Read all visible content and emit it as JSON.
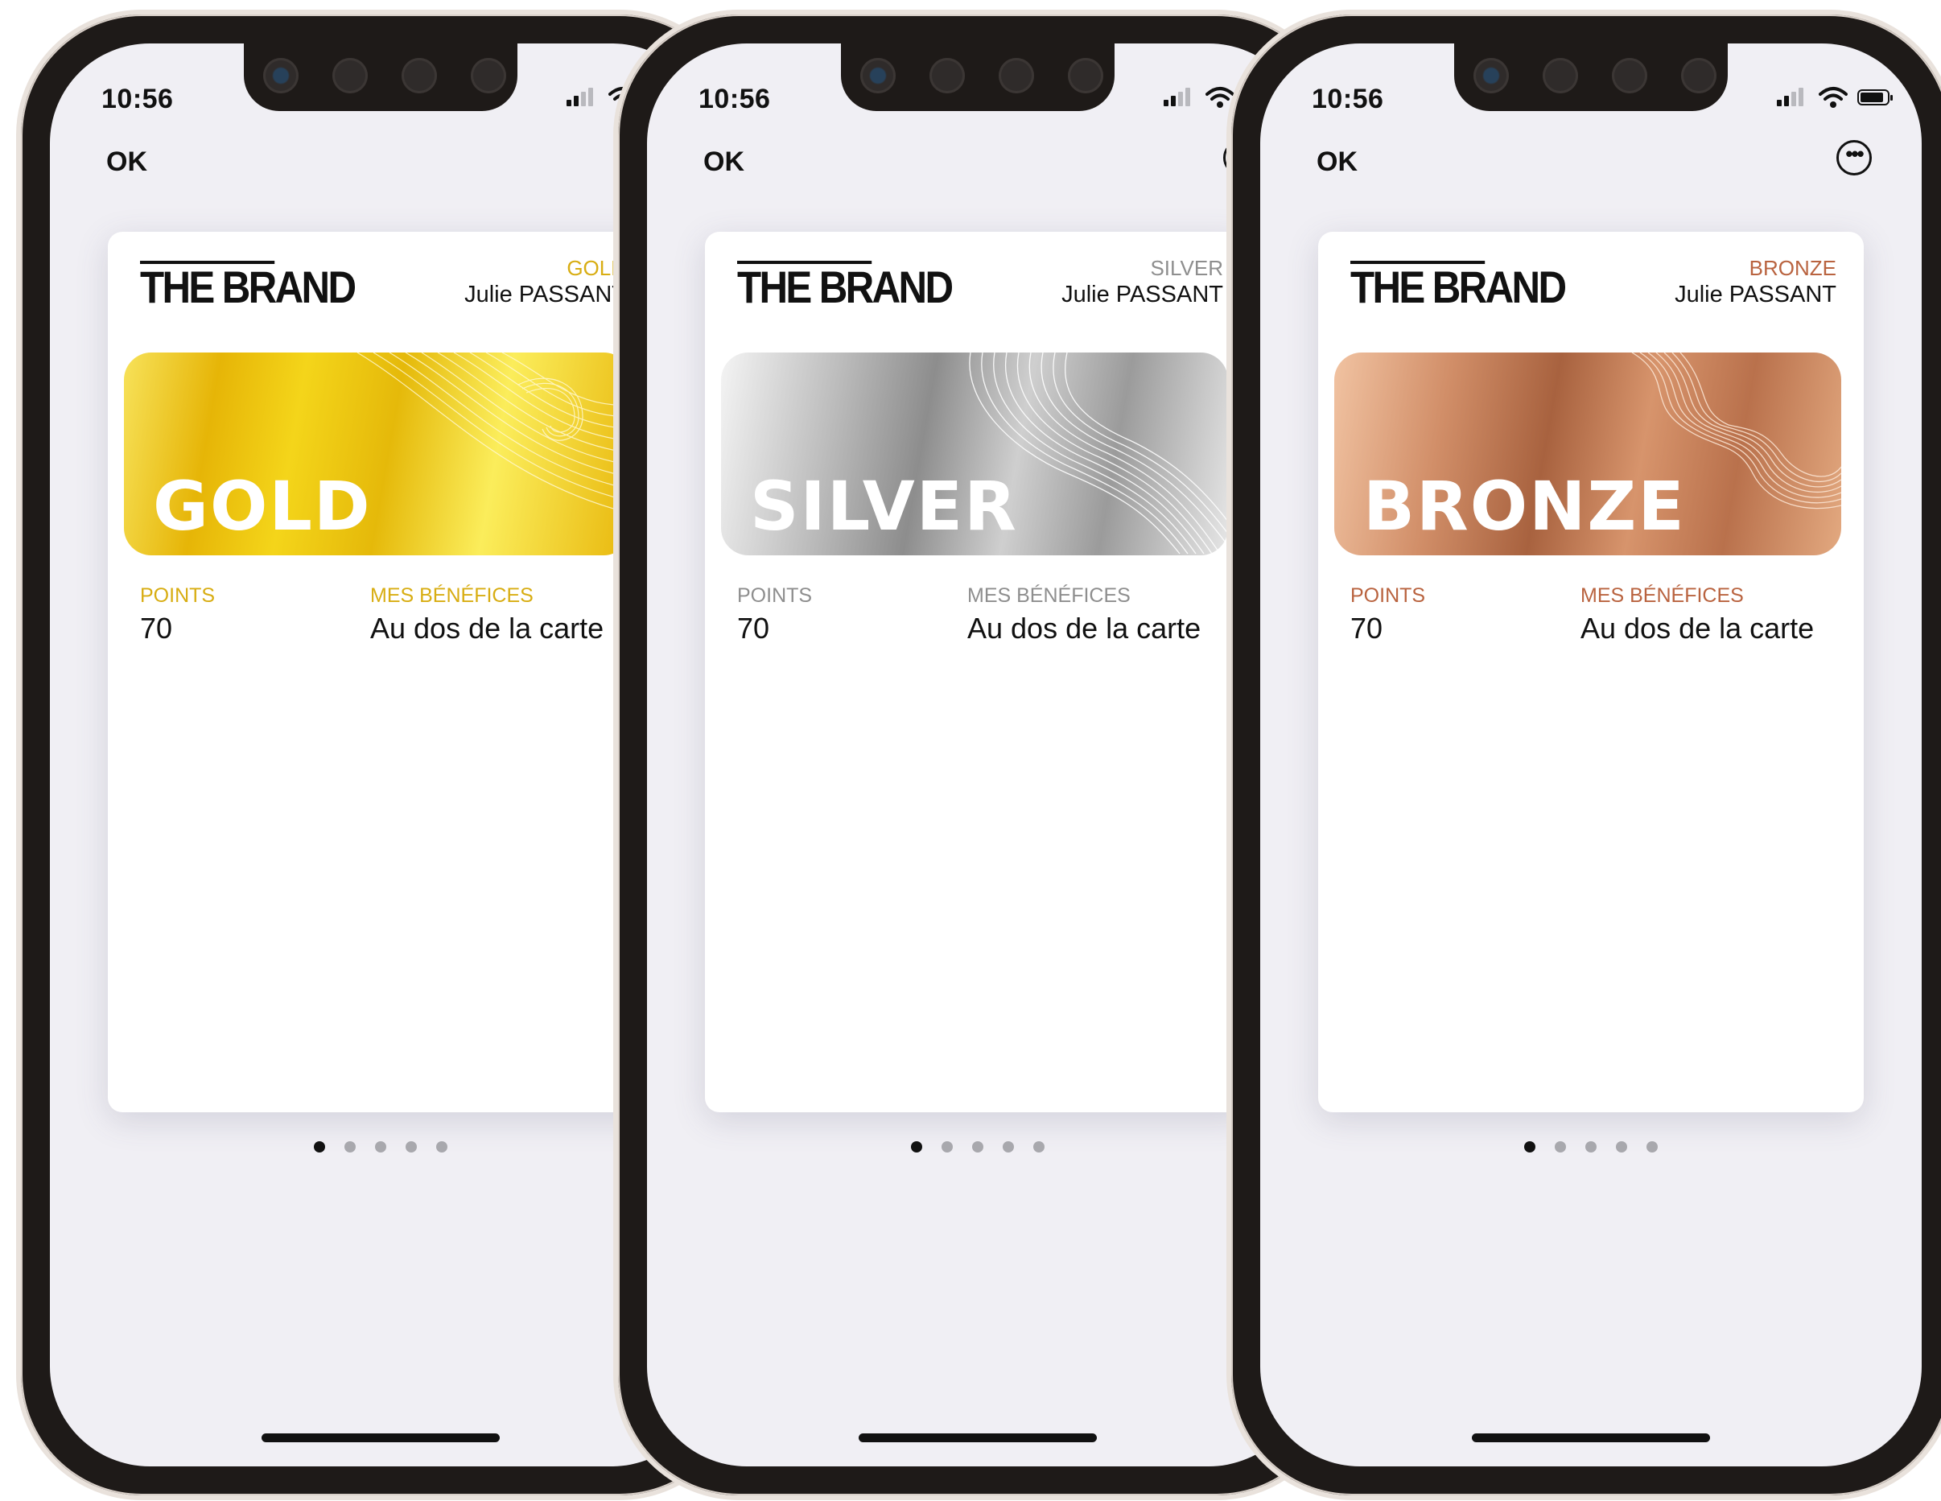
{
  "phones": [
    {
      "status": {
        "time": "10:56"
      },
      "nav": {
        "ok": "OK",
        "more_icon": "ellipsis-circle-icon"
      },
      "pass": {
        "brand": "THE BRAND",
        "tier": "GOLD",
        "holder": "Julie PASSANT",
        "banner_text": "GOLD",
        "points_label": "POINTS",
        "points_value": "70",
        "benefits_label": "MES BÉNÉFICES",
        "benefits_value": "Au dos de la carte",
        "accent_color": "#d8ad12"
      },
      "page_dots": {
        "count": 5,
        "active": 1
      }
    },
    {
      "status": {
        "time": "10:56"
      },
      "nav": {
        "ok": "OK",
        "more_icon": "ellipsis-circle-icon"
      },
      "pass": {
        "brand": "THE BRAND",
        "tier": "SILVER",
        "holder": "Julie PASSANT",
        "banner_text": "SILVER",
        "points_label": "POINTS",
        "points_value": "70",
        "benefits_label": "MES BÉNÉFICES",
        "benefits_value": "Au dos de la carte",
        "accent_color": "#8e8e8e"
      },
      "page_dots": {
        "count": 5,
        "active": 1
      }
    },
    {
      "status": {
        "time": "10:56"
      },
      "nav": {
        "ok": "OK",
        "more_icon": "ellipsis-circle-icon"
      },
      "pass": {
        "brand": "THE BRAND",
        "tier": "BRONZE",
        "holder": "Julie PASSANT",
        "banner_text": "BRONZE",
        "points_label": "POINTS",
        "points_value": "70",
        "benefits_label": "MES BÉNÉFICES",
        "benefits_value": "Au dos de la carte",
        "accent_color": "#b9633f"
      },
      "page_dots": {
        "count": 5,
        "active": 1
      }
    }
  ]
}
